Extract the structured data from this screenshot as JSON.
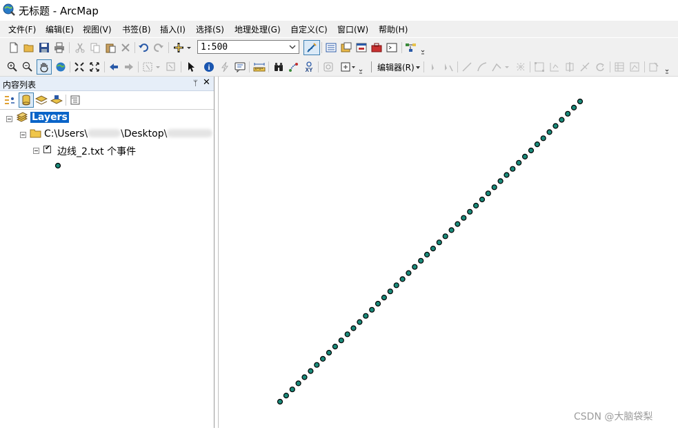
{
  "window": {
    "title": "无标题 - ArcMap",
    "icon": "arcmap-globe-icon"
  },
  "menu": [
    "文件(F)",
    "编辑(E)",
    "视图(V)",
    "书签(B)",
    "插入(I)",
    "选择(S)",
    "地理处理(G)",
    "自定义(C)",
    "窗口(W)",
    "帮助(H)"
  ],
  "standard_toolbar": {
    "scale_value": "1:500",
    "icons": [
      "new-document-icon",
      "open-folder-icon",
      "save-icon",
      "print-icon",
      "cut-icon",
      "copy-icon",
      "paste-icon",
      "delete-icon",
      "undo-icon",
      "redo-icon",
      "add-data-icon",
      "editor-toolbar-icon",
      "table-of-contents-icon",
      "catalog-icon",
      "search-window-icon",
      "arctoolbox-icon",
      "python-icon",
      "model-builder-icon"
    ]
  },
  "tools_toolbar": {
    "editor_label": "编辑器(R)",
    "icons": [
      "zoom-in-icon",
      "zoom-out-icon",
      "pan-icon",
      "full-extent-icon",
      "fixed-zoom-in-icon",
      "fixed-zoom-out-icon",
      "back-extent-icon",
      "forward-extent-icon",
      "select-features-icon",
      "clear-selection-icon",
      "select-elements-icon",
      "identify-icon",
      "hyperlink-icon",
      "html-popup-icon",
      "measure-icon",
      "find-icon",
      "find-route-icon",
      "go-to-xy-icon",
      "time-slider-icon",
      "create-viewer-icon"
    ]
  },
  "toc": {
    "title": "内容列表",
    "pin": "ᛘ",
    "close": "✕",
    "tools": [
      "list-by-drawing-order-icon",
      "list-by-source-icon",
      "list-by-visibility-icon",
      "list-by-selection-icon",
      "options-icon"
    ],
    "data_frame": "Layers",
    "folder_path": "C:\\Users\\",
    "folder_path_2": "\\Desktop\\",
    "layer_name": "边线_2.txt 个事件",
    "layer_checked": true,
    "symbol_color": "#1a8a7a"
  },
  "map": {
    "point_color": "#1a8a7a",
    "point_outline": "#000000",
    "points": 50,
    "start": [
      0.0,
      0.0
    ],
    "end": [
      1.0,
      1.0
    ]
  },
  "watermark": "CSDN @大脑袋梨"
}
